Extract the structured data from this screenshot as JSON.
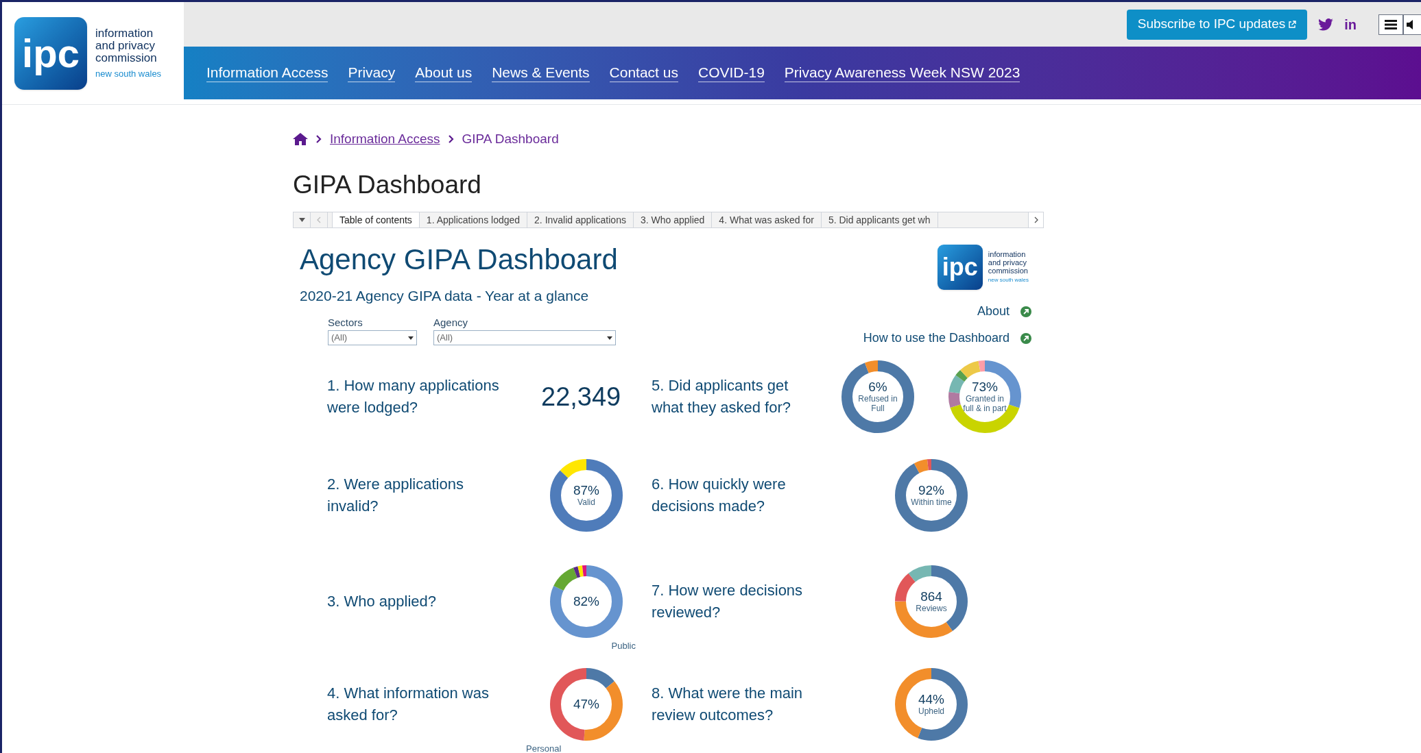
{
  "header": {
    "logo": {
      "mark": "ipc",
      "lines": [
        "information",
        "and privacy",
        "commission"
      ],
      "tagline": "new south wales"
    },
    "subscribe_button": "Subscribe to IPC updates",
    "linkedin": "in",
    "nav": [
      "Information Access",
      "Privacy",
      "About us",
      "News & Events",
      "Contact us",
      "COVID-19",
      "Privacy Awareness Week NSW 2023"
    ]
  },
  "breadcrumb": [
    "Information Access",
    "GIPA Dashboard"
  ],
  "page_title": "GIPA Dashboard",
  "tabs": [
    {
      "label": "Table of contents",
      "selected": true
    },
    {
      "label": "1. Applications lodged",
      "selected": false
    },
    {
      "label": "2. Invalid applications",
      "selected": false
    },
    {
      "label": "3. Who applied",
      "selected": false
    },
    {
      "label": "4. What was asked for",
      "selected": false
    },
    {
      "label": "5. Did applicants get wh",
      "selected": false
    }
  ],
  "dashboard": {
    "title": "Agency GIPA Dashboard",
    "subtitle": "2020-21 Agency GIPA data - Year at a glance",
    "logo": {
      "mark": "ipc",
      "lines": [
        "information",
        "and privacy",
        "commission"
      ],
      "tagline": "new south wales"
    },
    "filters": [
      {
        "label": "Sectors",
        "value": "(All)"
      },
      {
        "label": "Agency",
        "value": "(All)"
      }
    ],
    "links": [
      "About",
      "How to use the Dashboard"
    ],
    "questions": [
      {
        "label": "1. How many applications were lodged?",
        "kind": "number",
        "value": "22,349"
      },
      {
        "label": "2. Were applications invalid?",
        "kind": "donut",
        "charts": [
          {
            "value": "87%",
            "caption": "Valid"
          }
        ]
      },
      {
        "label": "3. Who applied?",
        "kind": "donut",
        "charts": [
          {
            "value": "82%",
            "note": "Public"
          }
        ]
      },
      {
        "label": "4. What information was asked for?",
        "kind": "donut",
        "charts": [
          {
            "value": "47%",
            "note": "Personal"
          }
        ]
      },
      {
        "label": "5. Did applicants get what they asked for?",
        "kind": "donut",
        "charts": [
          {
            "value": "6%",
            "caption": "Refused in Full"
          },
          {
            "value": "73%",
            "caption": "Granted in full & in part"
          }
        ]
      },
      {
        "label": "6. How quickly were decisions made?",
        "kind": "donut",
        "charts": [
          {
            "value": "92%",
            "caption": "Within time"
          }
        ]
      },
      {
        "label": "7. How were decisions reviewed?",
        "kind": "donut",
        "charts": [
          {
            "value": "864",
            "caption": "Reviews"
          }
        ]
      },
      {
        "label": "8. What were the main review outcomes?",
        "kind": "donut",
        "charts": [
          {
            "value": "44%",
            "caption": "Upheld"
          }
        ]
      }
    ]
  }
}
